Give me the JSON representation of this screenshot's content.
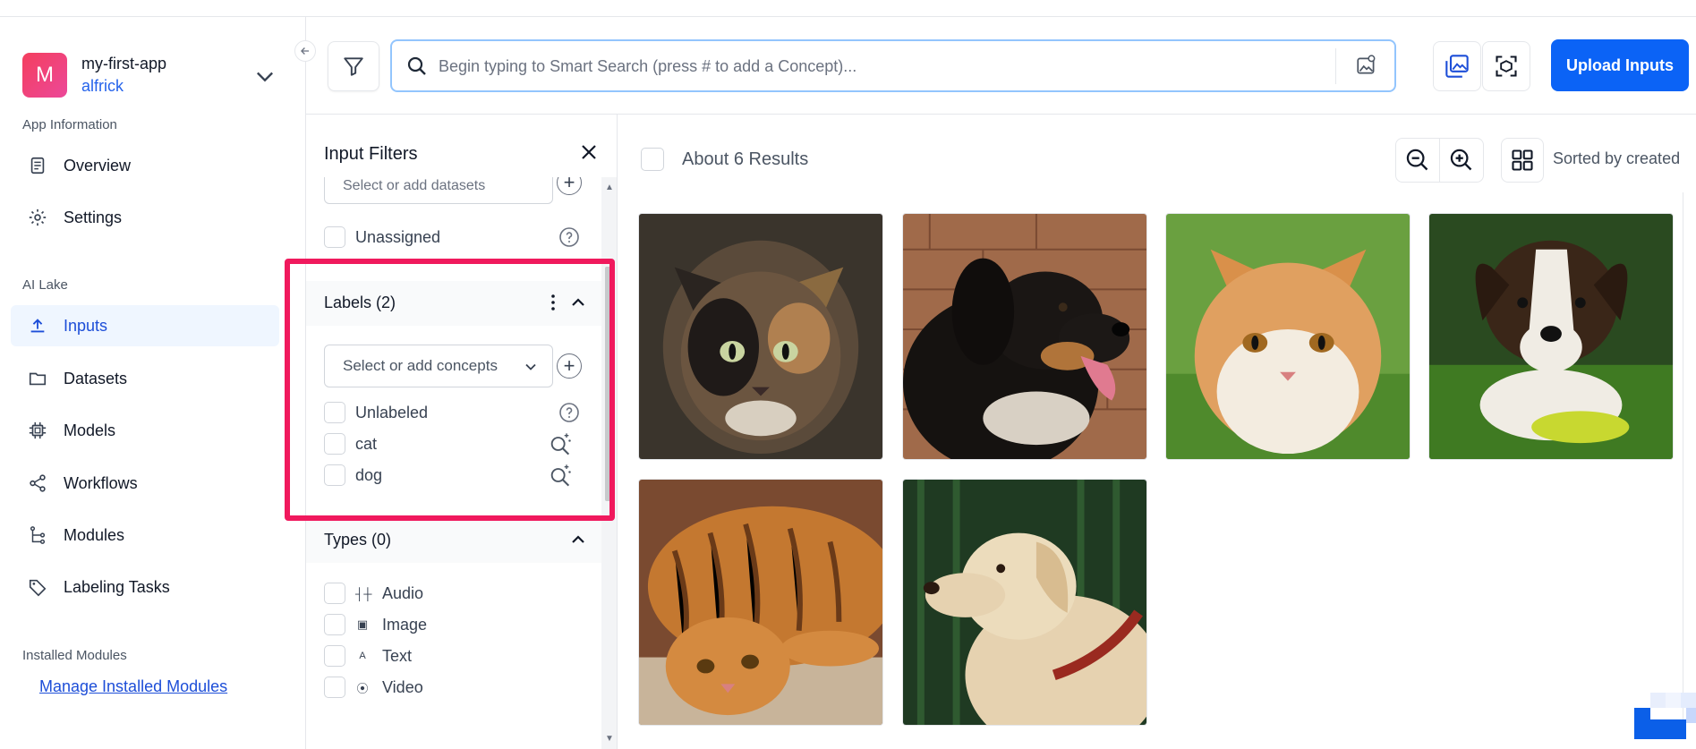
{
  "app": {
    "avatar_letter": "M",
    "name": "my-first-app",
    "user": "alfrick"
  },
  "sidebar": {
    "section_app_info": "App Information",
    "section_ai_lake": "AI Lake",
    "section_installed": "Installed Modules",
    "items": [
      {
        "label": "Overview",
        "icon": "document-icon"
      },
      {
        "label": "Settings",
        "icon": "gear-icon"
      },
      {
        "label": "Inputs",
        "icon": "upload-icon",
        "active": true
      },
      {
        "label": "Datasets",
        "icon": "folder-icon"
      },
      {
        "label": "Models",
        "icon": "chip-icon"
      },
      {
        "label": "Workflows",
        "icon": "share-icon"
      },
      {
        "label": "Modules",
        "icon": "tree-icon"
      },
      {
        "label": "Labeling Tasks",
        "icon": "tag-icon"
      }
    ],
    "manage_link": "Manage Installed Modules"
  },
  "search": {
    "placeholder": "Begin typing to Smart Search (press # to add a Concept)..."
  },
  "toolbar": {
    "upload_label": "Upload Inputs"
  },
  "filters": {
    "title": "Input Filters",
    "dataset_placeholder": "Select or add datasets",
    "unassigned": "Unassigned",
    "labels_title": "Labels (2)",
    "concept_placeholder": "Select or add concepts",
    "labels": [
      "Unlabeled",
      "cat",
      "dog"
    ],
    "types_title": "Types (0)",
    "types": [
      {
        "label": "Audio",
        "icon": "audio-icon"
      },
      {
        "label": "Image",
        "icon": "image-icon"
      },
      {
        "label": "Text",
        "icon": "text-icon"
      },
      {
        "label": "Video",
        "icon": "video-icon"
      }
    ]
  },
  "results": {
    "count_text": "About 6 Results",
    "sort_label": "Sorted by created",
    "thumbnails": [
      "calico cat",
      "black dog",
      "orange cat",
      "brown white dog",
      "tabby cat lying",
      "yellow labrador"
    ]
  },
  "colors": {
    "accent": "#0b63f6",
    "highlight": "#f0195d",
    "active_nav_bg": "#eff6ff"
  }
}
